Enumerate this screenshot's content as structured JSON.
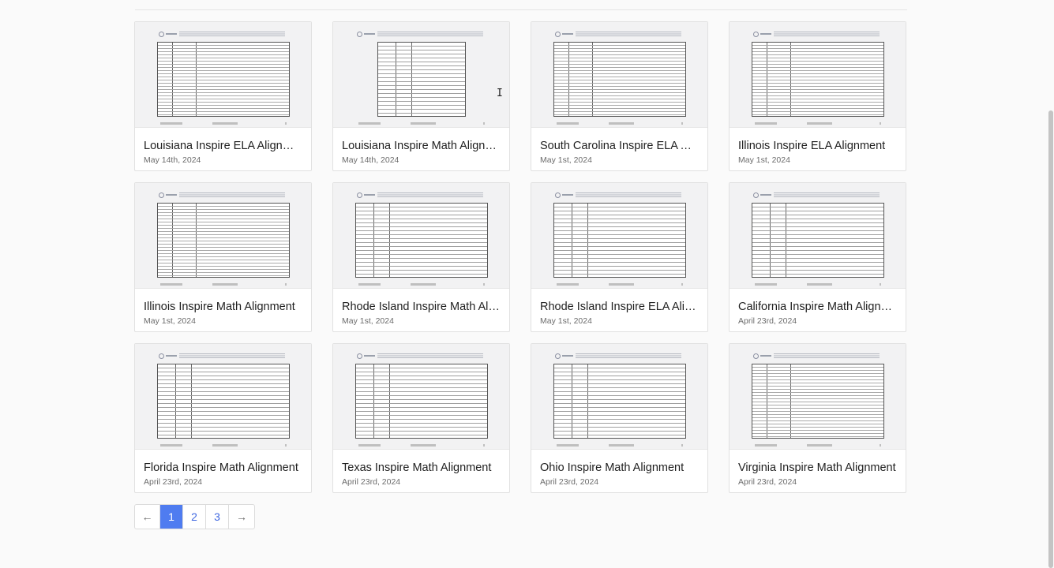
{
  "documents": [
    {
      "title": "Louisiana Inspire ELA Alignment",
      "date": "May 14th, 2024"
    },
    {
      "title": "Louisiana Inspire Math Alignment",
      "date": "May 14th, 2024"
    },
    {
      "title": "South Carolina Inspire ELA Alignment",
      "date": "May 1st, 2024"
    },
    {
      "title": "Illinois Inspire ELA Alignment",
      "date": "May 1st, 2024"
    },
    {
      "title": "Illinois Inspire Math Alignment",
      "date": "May 1st, 2024"
    },
    {
      "title": "Rhode Island Inspire Math Alignment",
      "date": "May 1st, 2024"
    },
    {
      "title": "Rhode Island Inspire ELA Alignment",
      "date": "May 1st, 2024"
    },
    {
      "title": "California Inspire Math Alignment",
      "date": "April 23rd, 2024"
    },
    {
      "title": "Florida Inspire Math Alignment",
      "date": "April 23rd, 2024"
    },
    {
      "title": "Texas Inspire Math Alignment",
      "date": "April 23rd, 2024"
    },
    {
      "title": "Ohio Inspire Math Alignment",
      "date": "April 23rd, 2024"
    },
    {
      "title": "Virginia Inspire Math Alignment",
      "date": "April 23rd, 2024"
    }
  ],
  "pagination": {
    "prev": "←",
    "pages": [
      "1",
      "2",
      "3"
    ],
    "current": "1",
    "next": "→"
  },
  "colors": {
    "accent": "#4f7cf0",
    "link": "#4169e1"
  }
}
